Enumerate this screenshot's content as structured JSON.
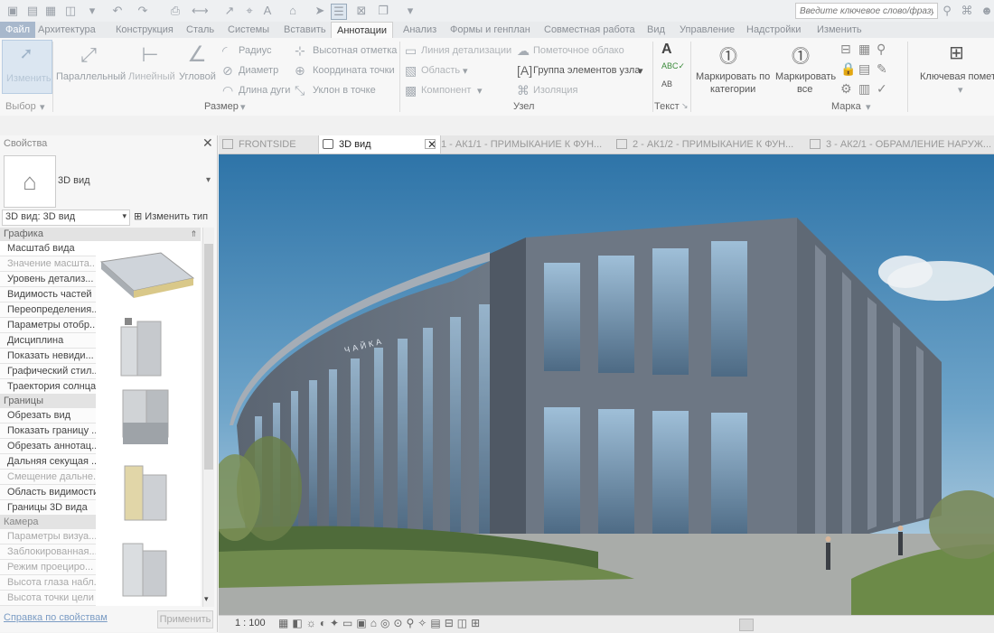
{
  "search": {
    "placeholder": "Введите ключевое слово/фразу"
  },
  "tabs": [
    "Файл",
    "Архитектура",
    "Конструкция",
    "Сталь",
    "Системы",
    "Вставить",
    "Аннотации",
    "Анализ",
    "Формы и генплан",
    "Совместная работа",
    "Вид",
    "Управление",
    "Надстройки",
    "Изменить"
  ],
  "ribbon": {
    "select": {
      "modify": "Изменить",
      "panel": "Выбор"
    },
    "dimension": {
      "parallel": "Параллельный",
      "linear": "Линейный",
      "angular": "Угловой",
      "radius": "Радиус",
      "diameter": "Диаметр",
      "arc_length": "Длина дуги",
      "spot_elevation": "Высотная отметка",
      "spot_coordinate": "Координата точки",
      "spot_slope": "Уклон в точке",
      "panel": "Размер"
    },
    "detail": {
      "detail_line": "Линия детализации",
      "region": "Область",
      "component": "Компонент",
      "revision_cloud": "Пометочное облако",
      "detail_group": "Группа элементов узла",
      "insulation": "Изоляция",
      "panel": "Узел"
    },
    "text": {
      "panel": "Текст"
    },
    "tag": {
      "by_category_1": "Маркировать по",
      "by_category_2": "категории",
      "all_1": "Маркировать",
      "all_2": "все",
      "panel": "Марка"
    },
    "keynote": {
      "label": "Ключевая помет"
    }
  },
  "properties": {
    "title": "Свойства",
    "type_name": "3D вид",
    "instance": "3D вид: 3D вид",
    "edit_type": "Изменить тип",
    "groups": {
      "graphics": "Графика",
      "extents": "Границы",
      "camera": "Камера"
    },
    "graphics_rows": [
      "Масштаб вида",
      "Значение масшта...",
      "Уровень детализ...",
      "Видимость частей",
      "Переопределения...",
      "Параметры отобр...",
      "Дисциплина",
      "Показать невиди...",
      "Графический стил...",
      "Траектория солнца"
    ],
    "extents_rows": [
      "Обрезать вид",
      "Показать границу ...",
      "Обрезать аннотац...",
      "Дальняя секущая ...",
      "Смещение дальне...",
      "Область видимости",
      "Границы 3D вида"
    ],
    "camera_rows": [
      "Параметры визуа...",
      "Заблокированная...",
      "Режим проециро...",
      "Высота глаза набл...",
      "Высота точки цели"
    ],
    "help_link": "Справка по свойствам",
    "apply": "Применить"
  },
  "doc_tabs": [
    "FRONTSIDE",
    "3D вид",
    "1 - АК1/1 - ПРИМЫКАНИЕ К ФУН...",
    "2 - АК1/2 - ПРИМЫКАНИЕ К ФУН...",
    "3 - АК2/1 - ОБРАМЛЕНИЕ НАРУЖ..."
  ],
  "building": {
    "sign": "ЧАЙКА"
  },
  "status": {
    "scale": "1 : 100"
  }
}
